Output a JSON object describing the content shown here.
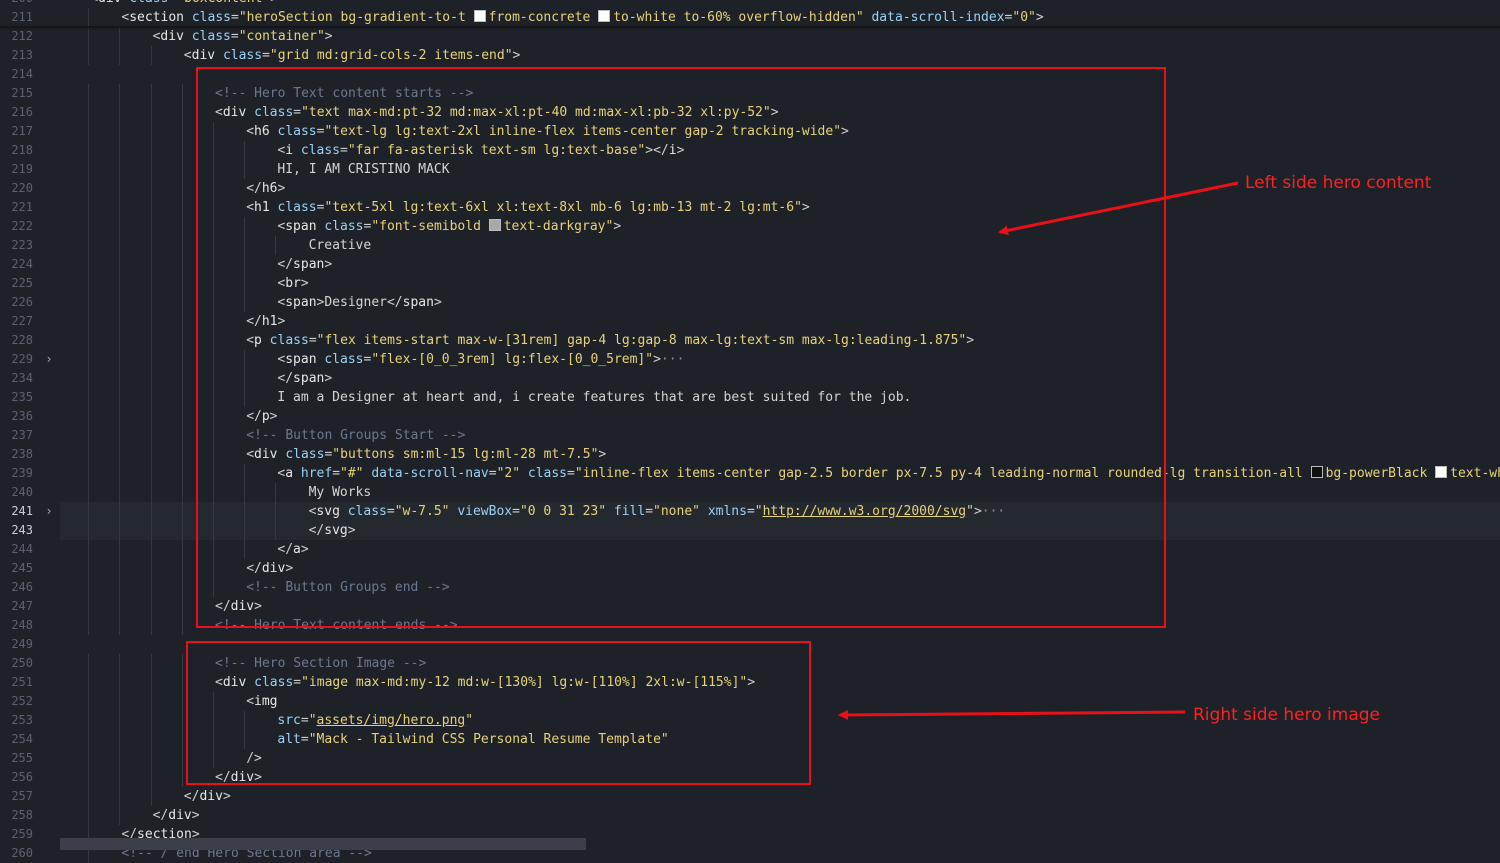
{
  "editor": {
    "lines": [
      {
        "no": "200",
        "indent": 1,
        "segs": [
          [
            "punc",
            "<"
          ],
          [
            "tag",
            "div"
          ],
          [
            "sp",
            " "
          ],
          [
            "attr",
            "class"
          ],
          [
            "eq",
            "="
          ],
          [
            "str",
            "\"boxContent\""
          ],
          [
            "punc",
            ">"
          ]
        ]
      },
      {
        "no": "211",
        "indent": 2,
        "segs": [
          [
            "punc",
            "<"
          ],
          [
            "tag",
            "section"
          ],
          [
            "sp",
            " "
          ],
          [
            "attr",
            "class"
          ],
          [
            "eq",
            "="
          ],
          [
            "str",
            "\"heroSection bg-gradient-to-t "
          ],
          [
            "sw",
            "#ffffff"
          ],
          [
            "str",
            "from-concrete "
          ],
          [
            "sw",
            "#ffffff"
          ],
          [
            "str",
            "to-white to-60% overflow-hidden\""
          ],
          [
            "sp",
            " "
          ],
          [
            "attr",
            "data-scroll-index"
          ],
          [
            "eq",
            "="
          ],
          [
            "str",
            "\"0\""
          ],
          [
            "punc",
            ">"
          ]
        ]
      },
      {
        "no": "212",
        "indent": 3,
        "segs": [
          [
            "punc",
            "<"
          ],
          [
            "tag",
            "div"
          ],
          [
            "sp",
            " "
          ],
          [
            "attr",
            "class"
          ],
          [
            "eq",
            "="
          ],
          [
            "str",
            "\"container\""
          ],
          [
            "punc",
            ">"
          ]
        ]
      },
      {
        "no": "213",
        "indent": 4,
        "segs": [
          [
            "punc",
            "<"
          ],
          [
            "tag",
            "div"
          ],
          [
            "sp",
            " "
          ],
          [
            "attr",
            "class"
          ],
          [
            "eq",
            "="
          ],
          [
            "str",
            "\"grid md:grid-cols-2 items-end\""
          ],
          [
            "punc",
            ">"
          ]
        ]
      },
      {
        "no": "214",
        "indent": 0,
        "segs": []
      },
      {
        "no": "215",
        "indent": 5,
        "segs": [
          [
            "com",
            "<!-- Hero Text content starts -->"
          ]
        ]
      },
      {
        "no": "216",
        "indent": 5,
        "segs": [
          [
            "punc",
            "<"
          ],
          [
            "tag",
            "div"
          ],
          [
            "sp",
            " "
          ],
          [
            "attr",
            "class"
          ],
          [
            "eq",
            "="
          ],
          [
            "str",
            "\"text max-md:pt-32 md:max-xl:pt-40 md:max-xl:pb-32 xl:py-52\""
          ],
          [
            "punc",
            ">"
          ]
        ]
      },
      {
        "no": "217",
        "indent": 6,
        "segs": [
          [
            "punc",
            "<"
          ],
          [
            "tag",
            "h6"
          ],
          [
            "sp",
            " "
          ],
          [
            "attr",
            "class"
          ],
          [
            "eq",
            "="
          ],
          [
            "str",
            "\"text-lg lg:text-2xl inline-flex items-center gap-2 tracking-wide\""
          ],
          [
            "punc",
            ">"
          ]
        ]
      },
      {
        "no": "218",
        "indent": 7,
        "segs": [
          [
            "punc",
            "<"
          ],
          [
            "tag",
            "i"
          ],
          [
            "sp",
            " "
          ],
          [
            "attr",
            "class"
          ],
          [
            "eq",
            "="
          ],
          [
            "str",
            "\"far fa-asterisk text-sm lg:text-base\""
          ],
          [
            "punc",
            "></"
          ],
          [
            "tag",
            "i"
          ],
          [
            "punc",
            ">"
          ]
        ]
      },
      {
        "no": "219",
        "indent": 7,
        "segs": [
          [
            "txt",
            "HI, I AM CRISTINO MACK"
          ]
        ]
      },
      {
        "no": "220",
        "indent": 6,
        "segs": [
          [
            "punc",
            "</"
          ],
          [
            "tag",
            "h6"
          ],
          [
            "punc",
            ">"
          ]
        ]
      },
      {
        "no": "221",
        "indent": 6,
        "segs": [
          [
            "punc",
            "<"
          ],
          [
            "tag",
            "h1"
          ],
          [
            "sp",
            " "
          ],
          [
            "attr",
            "class"
          ],
          [
            "eq",
            "="
          ],
          [
            "str",
            "\"text-5xl lg:text-6xl xl:text-8xl mb-6 lg:mb-13 mt-2 lg:mt-6\""
          ],
          [
            "punc",
            ">"
          ]
        ]
      },
      {
        "no": "222",
        "indent": 7,
        "segs": [
          [
            "punc",
            "<"
          ],
          [
            "tag",
            "span"
          ],
          [
            "sp",
            " "
          ],
          [
            "attr",
            "class"
          ],
          [
            "eq",
            "="
          ],
          [
            "str",
            "\"font-semibold "
          ],
          [
            "sw",
            "#a9a9a9"
          ],
          [
            "str",
            "text-darkgray\""
          ],
          [
            "punc",
            ">"
          ]
        ]
      },
      {
        "no": "223",
        "indent": 8,
        "segs": [
          [
            "txt",
            "Creative"
          ]
        ]
      },
      {
        "no": "224",
        "indent": 7,
        "segs": [
          [
            "punc",
            "</"
          ],
          [
            "tag",
            "span"
          ],
          [
            "punc",
            ">"
          ]
        ]
      },
      {
        "no": "225",
        "indent": 7,
        "segs": [
          [
            "punc",
            "<"
          ],
          [
            "tag",
            "br"
          ],
          [
            "punc",
            ">"
          ]
        ]
      },
      {
        "no": "226",
        "indent": 7,
        "segs": [
          [
            "punc",
            "<"
          ],
          [
            "tag",
            "span"
          ],
          [
            "punc",
            ">"
          ],
          [
            "txt",
            "Designer"
          ],
          [
            "punc",
            "</"
          ],
          [
            "tag",
            "span"
          ],
          [
            "punc",
            ">"
          ]
        ]
      },
      {
        "no": "227",
        "indent": 6,
        "segs": [
          [
            "punc",
            "</"
          ],
          [
            "tag",
            "h1"
          ],
          [
            "punc",
            ">"
          ]
        ]
      },
      {
        "no": "228",
        "indent": 6,
        "segs": [
          [
            "punc",
            "<"
          ],
          [
            "tag",
            "p"
          ],
          [
            "sp",
            " "
          ],
          [
            "attr",
            "class"
          ],
          [
            "eq",
            "="
          ],
          [
            "str",
            "\"flex items-start max-w-[31rem] gap-4 lg:gap-8 max-lg:text-sm max-lg:leading-1.875\""
          ],
          [
            "punc",
            ">"
          ]
        ]
      },
      {
        "no": "229",
        "indent": 7,
        "fold": "›",
        "segs": [
          [
            "punc",
            "<"
          ],
          [
            "tag",
            "span"
          ],
          [
            "sp",
            " "
          ],
          [
            "attr",
            "class"
          ],
          [
            "eq",
            "="
          ],
          [
            "str",
            "\"flex-[0_0_3rem] lg:flex-[0_0_5rem]\""
          ],
          [
            "punc",
            ">"
          ],
          [
            "ell",
            "···"
          ]
        ]
      },
      {
        "no": "234",
        "indent": 7,
        "segs": [
          [
            "punc",
            "</"
          ],
          [
            "tag",
            "span"
          ],
          [
            "punc",
            ">"
          ]
        ]
      },
      {
        "no": "235",
        "indent": 7,
        "segs": [
          [
            "txt",
            "I am a Designer at heart and, i create features that are best suited for the job."
          ]
        ]
      },
      {
        "no": "236",
        "indent": 6,
        "segs": [
          [
            "punc",
            "</"
          ],
          [
            "tag",
            "p"
          ],
          [
            "punc",
            ">"
          ]
        ]
      },
      {
        "no": "237",
        "indent": 6,
        "segs": [
          [
            "com",
            "<!-- Button Groups Start -->"
          ]
        ]
      },
      {
        "no": "238",
        "indent": 6,
        "segs": [
          [
            "punc",
            "<"
          ],
          [
            "tag",
            "div"
          ],
          [
            "sp",
            " "
          ],
          [
            "attr",
            "class"
          ],
          [
            "eq",
            "="
          ],
          [
            "str",
            "\"buttons sm:ml-15 lg:ml-28 mt-7.5\""
          ],
          [
            "punc",
            ">"
          ]
        ]
      },
      {
        "no": "239",
        "indent": 7,
        "segs": [
          [
            "punc",
            "<"
          ],
          [
            "tag",
            "a"
          ],
          [
            "sp",
            " "
          ],
          [
            "attr",
            "href"
          ],
          [
            "eq",
            "="
          ],
          [
            "str",
            "\"#\""
          ],
          [
            "sp",
            " "
          ],
          [
            "attr",
            "data-scroll-nav"
          ],
          [
            "eq",
            "="
          ],
          [
            "str",
            "\"2\""
          ],
          [
            "sp",
            " "
          ],
          [
            "attr",
            "class"
          ],
          [
            "eq",
            "="
          ],
          [
            "str",
            "\"inline-flex items-center gap-2.5 border px-7.5 py-4 leading-normal rounded-lg transition-all "
          ],
          [
            "sw",
            "#111111"
          ],
          [
            "str",
            "bg-powerBlack "
          ],
          [
            "sw",
            "#ffffff"
          ],
          [
            "str",
            "text-white"
          ]
        ]
      },
      {
        "no": "240",
        "indent": 8,
        "segs": [
          [
            "txt",
            "My Works"
          ]
        ]
      },
      {
        "no": "241",
        "indent": 8,
        "fold": "›",
        "hl": true,
        "segs": [
          [
            "punc",
            "<"
          ],
          [
            "tag",
            "svg"
          ],
          [
            "sp",
            " "
          ],
          [
            "attr",
            "class"
          ],
          [
            "eq",
            "="
          ],
          [
            "str",
            "\"w-7.5\""
          ],
          [
            "sp",
            " "
          ],
          [
            "attr",
            "viewBox"
          ],
          [
            "eq",
            "="
          ],
          [
            "str",
            "\"0 0 31 23\""
          ],
          [
            "sp",
            " "
          ],
          [
            "attr",
            "fill"
          ],
          [
            "eq",
            "="
          ],
          [
            "str",
            "\"none\""
          ],
          [
            "sp",
            " "
          ],
          [
            "attr",
            "xmlns"
          ],
          [
            "eq",
            "="
          ],
          [
            "str",
            "\""
          ],
          [
            "link",
            "http://www.w3.org/2000/svg"
          ],
          [
            "str",
            "\""
          ],
          [
            "punc",
            ">"
          ],
          [
            "ell",
            "···"
          ]
        ]
      },
      {
        "no": "243",
        "indent": 8,
        "cur": true,
        "segs": [
          [
            "punc",
            "</"
          ],
          [
            "tag",
            "svg"
          ],
          [
            "punc",
            ">"
          ]
        ]
      },
      {
        "no": "244",
        "indent": 7,
        "segs": [
          [
            "punc",
            "</"
          ],
          [
            "tag",
            "a"
          ],
          [
            "punc",
            ">"
          ]
        ]
      },
      {
        "no": "245",
        "indent": 6,
        "segs": [
          [
            "punc",
            "</"
          ],
          [
            "tag",
            "div"
          ],
          [
            "punc",
            ">"
          ]
        ]
      },
      {
        "no": "246",
        "indent": 6,
        "segs": [
          [
            "com",
            "<!-- Button Groups end -->"
          ]
        ]
      },
      {
        "no": "247",
        "indent": 5,
        "segs": [
          [
            "punc",
            "</"
          ],
          [
            "tag",
            "div"
          ],
          [
            "punc",
            ">"
          ]
        ]
      },
      {
        "no": "248",
        "indent": 5,
        "segs": [
          [
            "com",
            "<!-- Hero Text content ends -->"
          ]
        ]
      },
      {
        "no": "249",
        "indent": 0,
        "segs": []
      },
      {
        "no": "250",
        "indent": 5,
        "segs": [
          [
            "com",
            "<!-- Hero Section Image -->"
          ]
        ]
      },
      {
        "no": "251",
        "indent": 5,
        "segs": [
          [
            "punc",
            "<"
          ],
          [
            "tag",
            "div"
          ],
          [
            "sp",
            " "
          ],
          [
            "attr",
            "class"
          ],
          [
            "eq",
            "="
          ],
          [
            "str",
            "\"image max-md:my-12 md:w-[130%] lg:w-[110%] 2xl:w-[115%]\""
          ],
          [
            "punc",
            ">"
          ]
        ]
      },
      {
        "no": "252",
        "indent": 6,
        "segs": [
          [
            "punc",
            "<"
          ],
          [
            "tag",
            "img"
          ]
        ]
      },
      {
        "no": "253",
        "indent": 7,
        "segs": [
          [
            "attr",
            "src"
          ],
          [
            "eq",
            "="
          ],
          [
            "str",
            "\""
          ],
          [
            "link",
            "assets/img/hero.png"
          ],
          [
            "str",
            "\""
          ]
        ]
      },
      {
        "no": "254",
        "indent": 7,
        "segs": [
          [
            "attr",
            "alt"
          ],
          [
            "eq",
            "="
          ],
          [
            "str",
            "\"Mack - Tailwind CSS Personal Resume Template\""
          ]
        ]
      },
      {
        "no": "255",
        "indent": 6,
        "segs": [
          [
            "punc",
            "/>"
          ]
        ]
      },
      {
        "no": "256",
        "indent": 5,
        "segs": [
          [
            "punc",
            "</"
          ],
          [
            "tag",
            "div"
          ],
          [
            "punc",
            ">"
          ]
        ]
      },
      {
        "no": "257",
        "indent": 4,
        "segs": [
          [
            "punc",
            "</"
          ],
          [
            "tag",
            "div"
          ],
          [
            "punc",
            ">"
          ]
        ]
      },
      {
        "no": "258",
        "indent": 3,
        "segs": [
          [
            "punc",
            "</"
          ],
          [
            "tag",
            "div"
          ],
          [
            "punc",
            ">"
          ]
        ]
      },
      {
        "no": "259",
        "indent": 2,
        "segs": [
          [
            "punc",
            "</"
          ],
          [
            "tag",
            "section"
          ],
          [
            "punc",
            ">"
          ]
        ]
      },
      {
        "no": "260",
        "indent": 2,
        "segs": [
          [
            "com",
            "<!-- / end Hero Section area -->"
          ]
        ]
      }
    ]
  },
  "annotations": {
    "left_label": "Left side hero content",
    "right_label": "Right side hero image",
    "color": "#e8111a"
  }
}
